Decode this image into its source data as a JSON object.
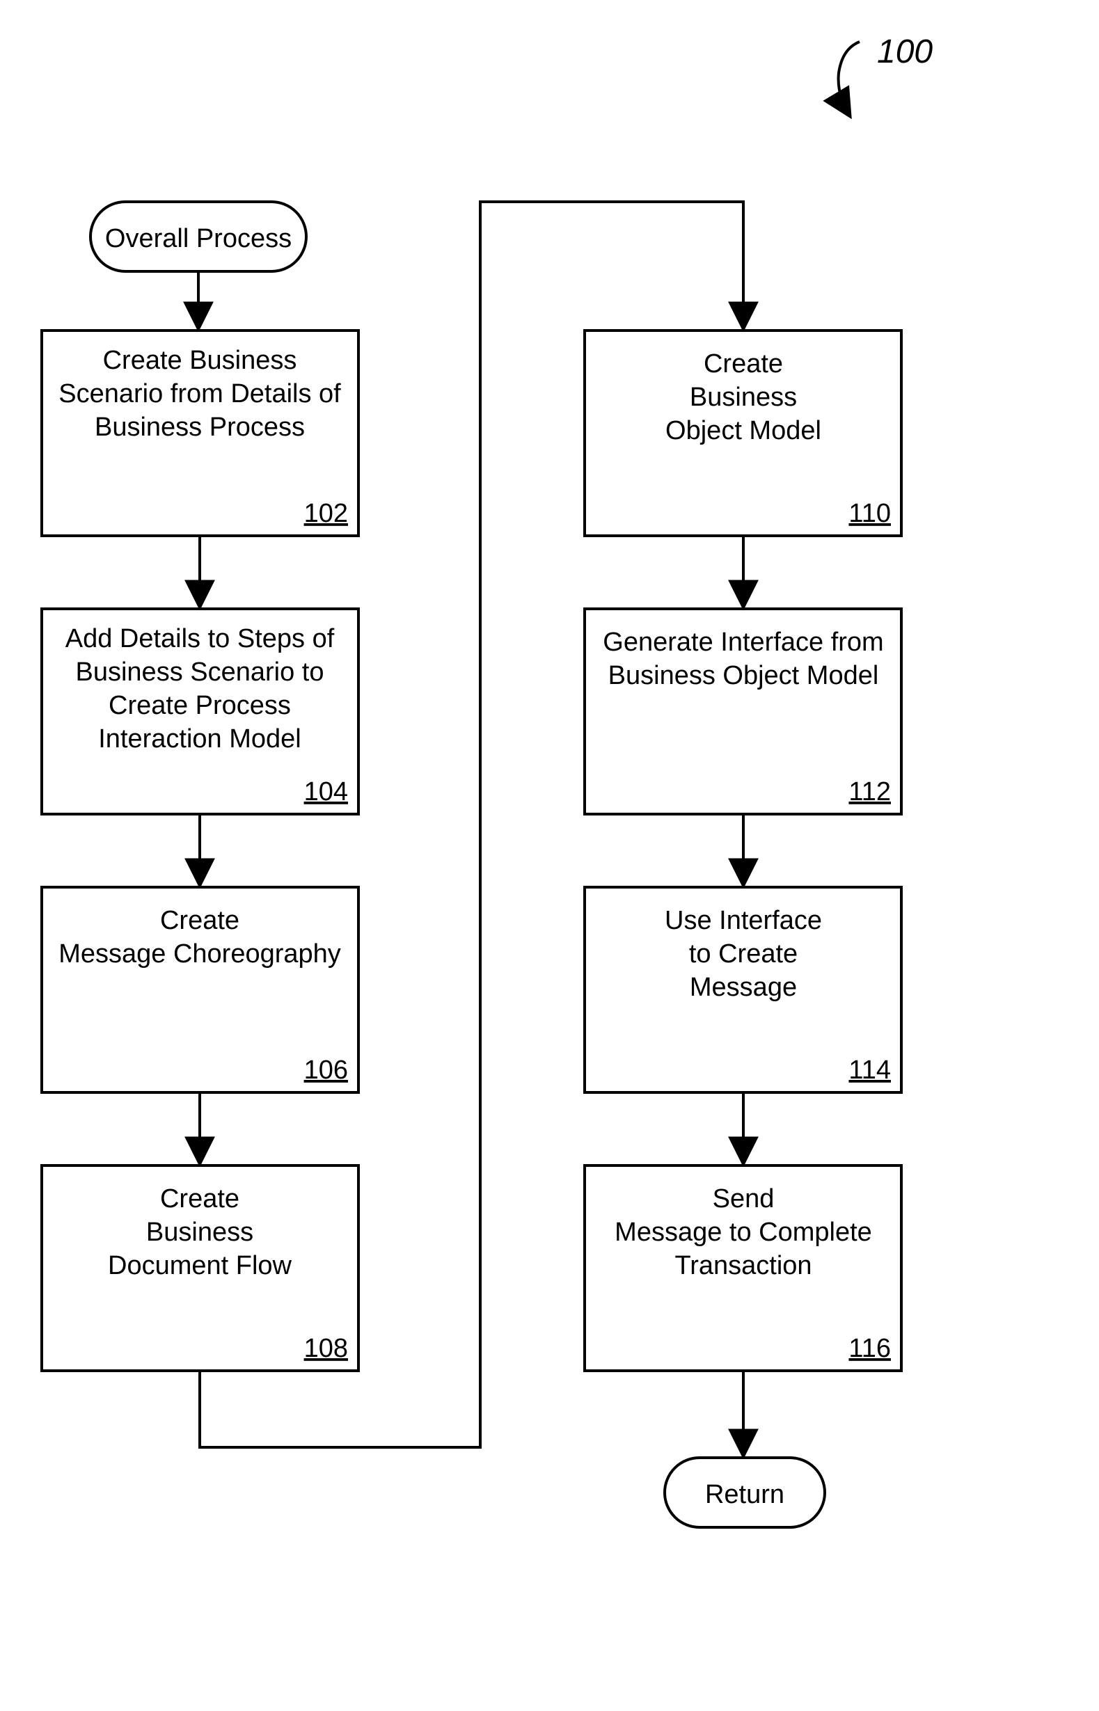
{
  "figure_label": "100",
  "start": {
    "label": "Overall Process"
  },
  "end": {
    "label": "Return"
  },
  "steps": [
    {
      "ref": "102",
      "lines": [
        "Create Business",
        "Scenario from Details of",
        "Business Process"
      ]
    },
    {
      "ref": "104",
      "lines": [
        "Add Details to Steps of",
        "Business Scenario to",
        "Create Process",
        "Interaction Model"
      ]
    },
    {
      "ref": "106",
      "lines": [
        "Create",
        "Message Choreography"
      ]
    },
    {
      "ref": "108",
      "lines": [
        "Create",
        "Business",
        "Document Flow"
      ]
    },
    {
      "ref": "110",
      "lines": [
        "Create",
        "Business",
        "Object Model"
      ]
    },
    {
      "ref": "112",
      "lines": [
        "Generate Interface from",
        "Business Object Model"
      ]
    },
    {
      "ref": "114",
      "lines": [
        "Use Interface",
        "to Create",
        "Message"
      ]
    },
    {
      "ref": "116",
      "lines": [
        "Send",
        "Message to Complete",
        "Transaction"
      ]
    }
  ]
}
